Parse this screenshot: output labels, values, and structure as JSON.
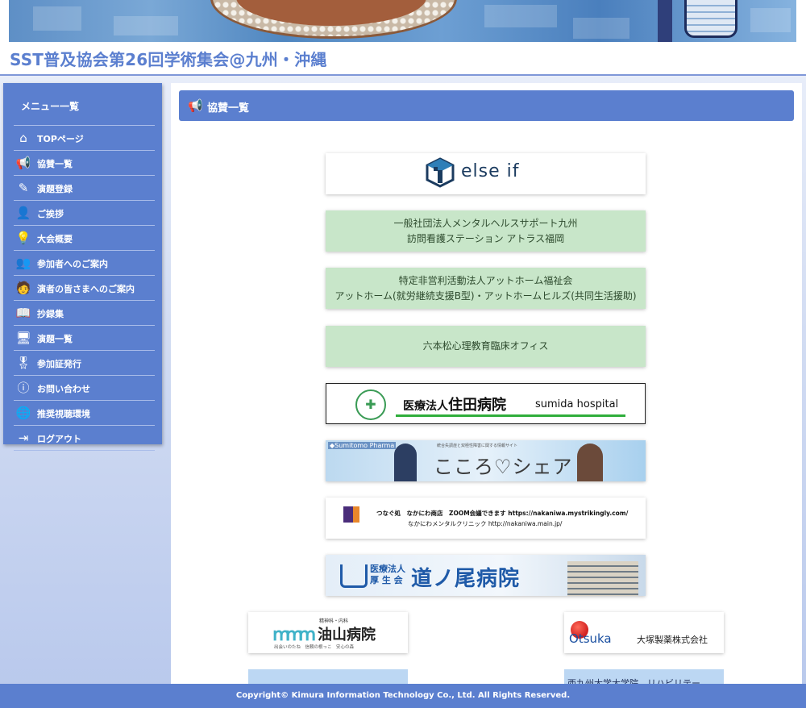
{
  "header": {
    "title": "SST普及協会第26回学術集会@九州・沖縄"
  },
  "sidebar": {
    "title": "メニュー一覧",
    "items": [
      {
        "label": "TOPページ",
        "icon": "home-icon",
        "glyph": "⌂"
      },
      {
        "label": "協賛一覧",
        "icon": "megaphone-icon",
        "glyph": "📢"
      },
      {
        "label": "演題登録",
        "icon": "edit-icon",
        "glyph": "✎"
      },
      {
        "label": "ご挨拶",
        "icon": "user-icon",
        "glyph": "👤"
      },
      {
        "label": "大会概要",
        "icon": "lightbulb-icon",
        "glyph": "💡"
      },
      {
        "label": "参加者へのご案内",
        "icon": "people-icon",
        "glyph": "👥"
      },
      {
        "label": "演者の皆さまへのご案内",
        "icon": "presenter-icon",
        "glyph": "🧑"
      },
      {
        "label": "抄録集",
        "icon": "book-icon",
        "glyph": "📖"
      },
      {
        "label": "演題一覧",
        "icon": "monitor-icon",
        "glyph": "🖥"
      },
      {
        "label": "参加証発行",
        "icon": "badge-icon",
        "glyph": "🎖"
      },
      {
        "label": "お問い合わせ",
        "icon": "info-icon",
        "glyph": "ⓘ"
      },
      {
        "label": "推奨視聴環境",
        "icon": "globe-icon",
        "glyph": "🌐"
      },
      {
        "label": "ログアウト",
        "icon": "logout-icon",
        "glyph": "⇥"
      }
    ]
  },
  "main": {
    "heading": "協賛一覧",
    "heading_icon": "megaphone-icon"
  },
  "sponsors": {
    "elseif": "else if",
    "mental_health": [
      "一般社団法人メンタルヘルスサポート九州",
      "訪問看護ステーション アトラス福岡"
    ],
    "athome": [
      "特定非営利活動法人アットホーム福祉会",
      "アットホーム(就労継続支援B型)・アットホームヒルズ(共同生活援助)"
    ],
    "roppongi": "六本松心理教育臨床オフィス",
    "sumida": {
      "corp": "医療法人",
      "name": "住田病院",
      "en": "sumida hospital"
    },
    "kokoro": {
      "brand": "◆Sumitomo Pharma",
      "sub": "統合失調症と双極性障害に関する情報サイト",
      "name": "こころ♡シェア"
    },
    "nakaniwa": {
      "line1": "つなぐ処　なかにわ商店　ZOOM会議できます https://nakaniwa.mystrikingly.com/",
      "line2": "なかにわメンタルクリニック http://nakaniwa.main.jp/"
    },
    "michinoo": {
      "corp1": "医療法人",
      "corp2": "厚 生 会",
      "name": "道ノ尾病院"
    },
    "aburayama": {
      "small": "精神科・内科",
      "name": "油山病院",
      "tag": "出会いのたね　信頼の根っこ　安心の森"
    },
    "otsuka": {
      "en": "Otsuka",
      "jp": "大塚製薬株式会社"
    },
    "partial_right": "西九州大学大学院　リハビリテー"
  },
  "footer": {
    "copyright": "Copyright© Kimura Information Technology Co., Ltd. All Rights Reserved."
  },
  "colors": {
    "accent": "#5b7fcf",
    "sponsor_green": "#c8e6c9",
    "title_blue": "#5b7fcf"
  }
}
